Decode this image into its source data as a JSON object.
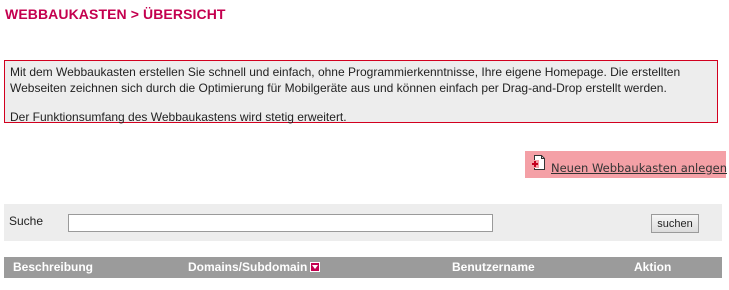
{
  "page": {
    "title": "WEBBAUKASTEN > ÜBERSICHT"
  },
  "info": {
    "paragraph1": "Mit dem Webbaukasten erstellen Sie schnell und einfach, ohne Programmierkenntnisse, Ihre eigene Homepage. Die erstellten Webseiten zeichnen sich durch die Optimierung für Mobilgeräte aus und können einfach per Drag-and-Drop erstellt werden.",
    "paragraph2": "Der Funktionsumfang des Webbaukastens wird stetig erweitert."
  },
  "actions": {
    "new_label": "Neuen Webbaukasten anlegen",
    "new_icon": "add-document-icon"
  },
  "search": {
    "label": "Suche",
    "value": "",
    "placeholder": "",
    "button_label": "suchen"
  },
  "table": {
    "columns": [
      "Beschreibung",
      "Domains/Subdomain",
      "Benutzername",
      "Aktion"
    ],
    "sort_icon": "sort-down-icon"
  },
  "colors": {
    "accent": "#c4004f",
    "border_red": "#d2001f",
    "highlight": "#f4a0a6",
    "panel_bg": "#ededed",
    "header_bg": "#9b9b9b"
  }
}
